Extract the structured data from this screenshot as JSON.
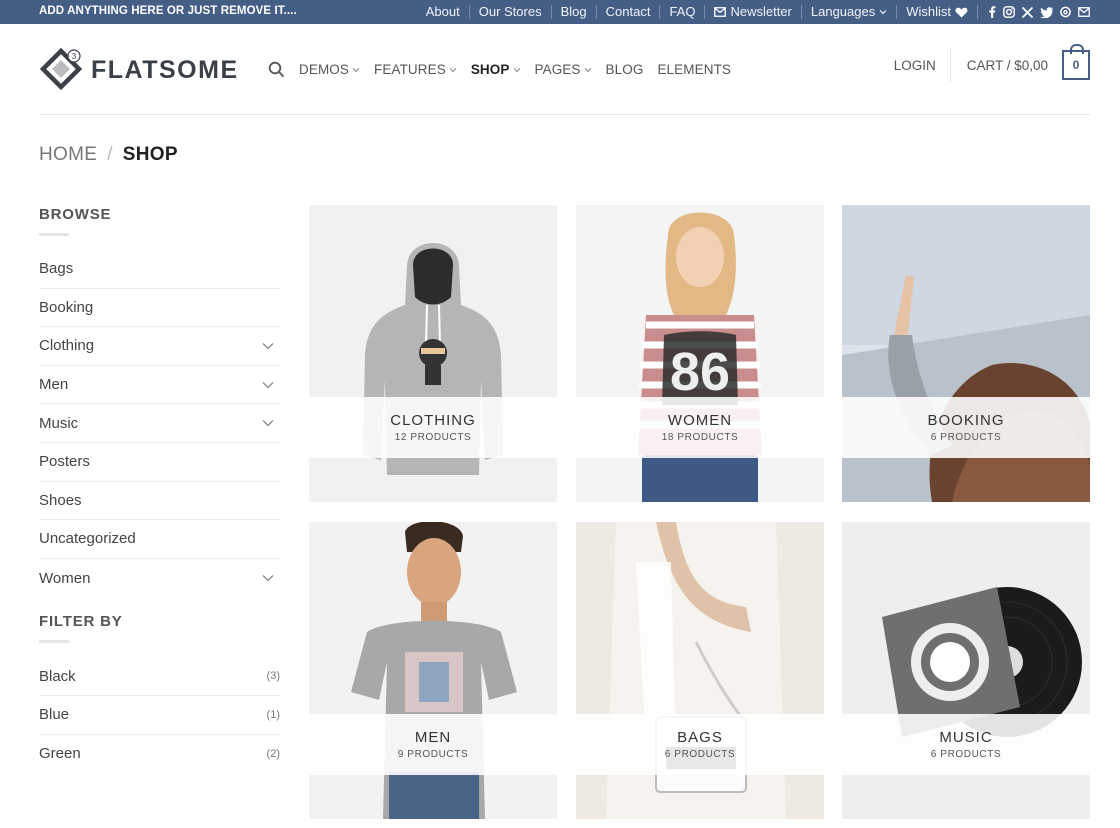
{
  "topbar": {
    "promo": "ADD ANYTHING HERE OR JUST REMOVE IT....",
    "links": [
      "About",
      "Our Stores",
      "Blog",
      "Contact",
      "FAQ"
    ],
    "newsletter": "Newsletter",
    "languages": "Languages",
    "wishlist": "Wishlist",
    "social_icons": [
      "facebook-icon",
      "instagram-icon",
      "x-icon",
      "twitter-icon",
      "threads-icon",
      "email-icon"
    ],
    "bg_color": "#445e85"
  },
  "header": {
    "logo_text": "FLATSOME",
    "logo_badge": "3",
    "nav": [
      {
        "label": "DEMOS",
        "dropdown": true,
        "active": false
      },
      {
        "label": "FEATURES",
        "dropdown": true,
        "active": false
      },
      {
        "label": "SHOP",
        "dropdown": true,
        "active": true
      },
      {
        "label": "PAGES",
        "dropdown": true,
        "active": false
      },
      {
        "label": "BLOG",
        "dropdown": false,
        "active": false
      },
      {
        "label": "ELEMENTS",
        "dropdown": false,
        "active": false
      }
    ],
    "login": "LOGIN",
    "cart_label": "CART / $0,00",
    "cart_count": "0"
  },
  "breadcrumb": {
    "home": "HOME",
    "separator": "/",
    "current": "SHOP"
  },
  "sidebar": {
    "browse_title": "BROWSE",
    "categories": [
      {
        "label": "Bags",
        "expandable": false
      },
      {
        "label": "Booking",
        "expandable": false
      },
      {
        "label": "Clothing",
        "expandable": true
      },
      {
        "label": "Men",
        "expandable": true
      },
      {
        "label": "Music",
        "expandable": true
      },
      {
        "label": "Posters",
        "expandable": false
      },
      {
        "label": "Shoes",
        "expandable": false
      },
      {
        "label": "Uncategorized",
        "expandable": false
      },
      {
        "label": "Women",
        "expandable": true
      }
    ],
    "filter_title": "FILTER BY",
    "filters": [
      {
        "label": "Black",
        "count": "(3)"
      },
      {
        "label": "Blue",
        "count": "(1)"
      },
      {
        "label": "Green",
        "count": "(2)"
      }
    ]
  },
  "categories_grid": [
    {
      "name": "CLOTHING",
      "count": "12 PRODUCTS",
      "image": "hoodie"
    },
    {
      "name": "WOMEN",
      "count": "18 PRODUCTS",
      "image": "woman"
    },
    {
      "name": "BOOKING",
      "count": "6 PRODUCTS",
      "image": "booking"
    },
    {
      "name": "MEN",
      "count": "9 PRODUCTS",
      "image": "man"
    },
    {
      "name": "BAGS",
      "count": "6 PRODUCTS",
      "image": "bag"
    },
    {
      "name": "MUSIC",
      "count": "6 PRODUCTS",
      "image": "vinyl"
    }
  ]
}
